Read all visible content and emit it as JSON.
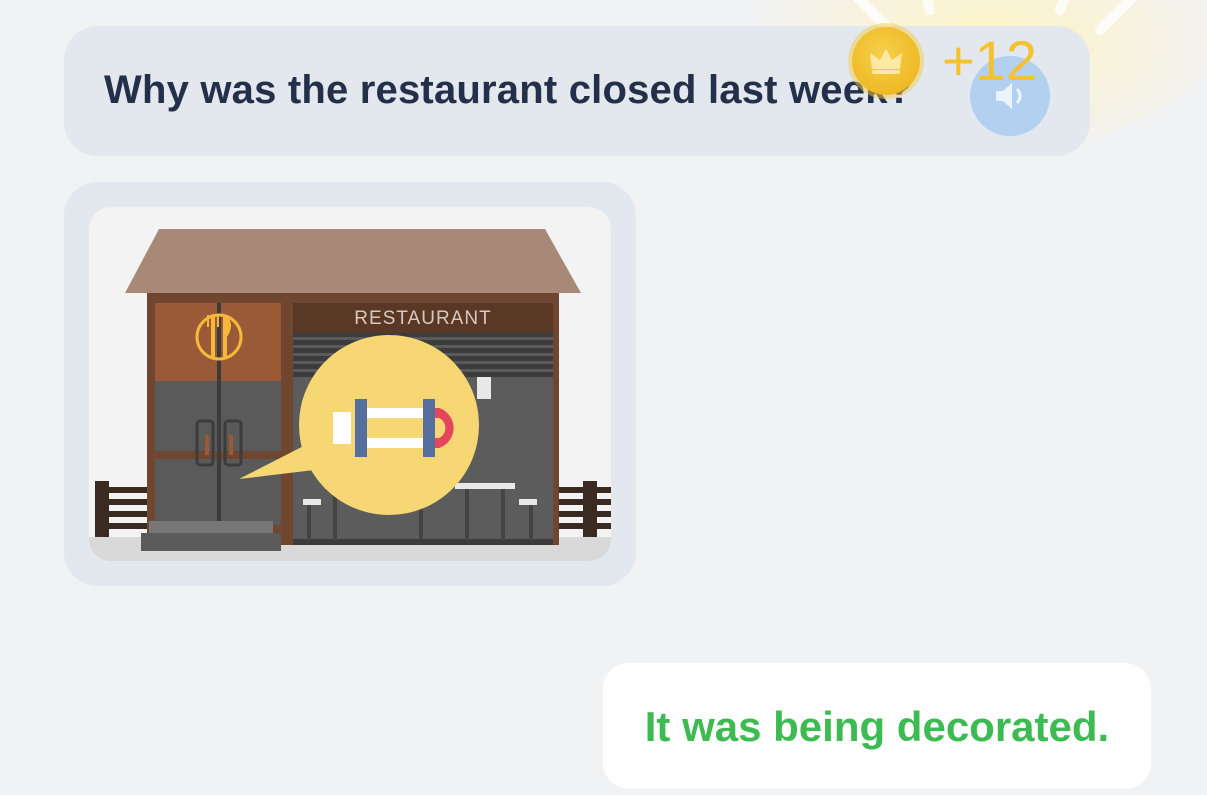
{
  "question": {
    "text": "Why was the restaurant closed last week?",
    "speaker_icon": "speaker-icon"
  },
  "reward": {
    "points_label": "+12",
    "coin_icon": "crown-coin-icon",
    "color": "#f4c22e"
  },
  "illustration": {
    "sign_text": "RESTAURANT",
    "sign_icon": "fork-knife-icon",
    "speech_icon": "magnet-icon"
  },
  "answer": {
    "text": "It was being decorated.",
    "color": "#3dbb52"
  },
  "colors": {
    "background": "#f1f2f4",
    "bubble": "#e3e7ee",
    "question_text": "#24304a"
  }
}
